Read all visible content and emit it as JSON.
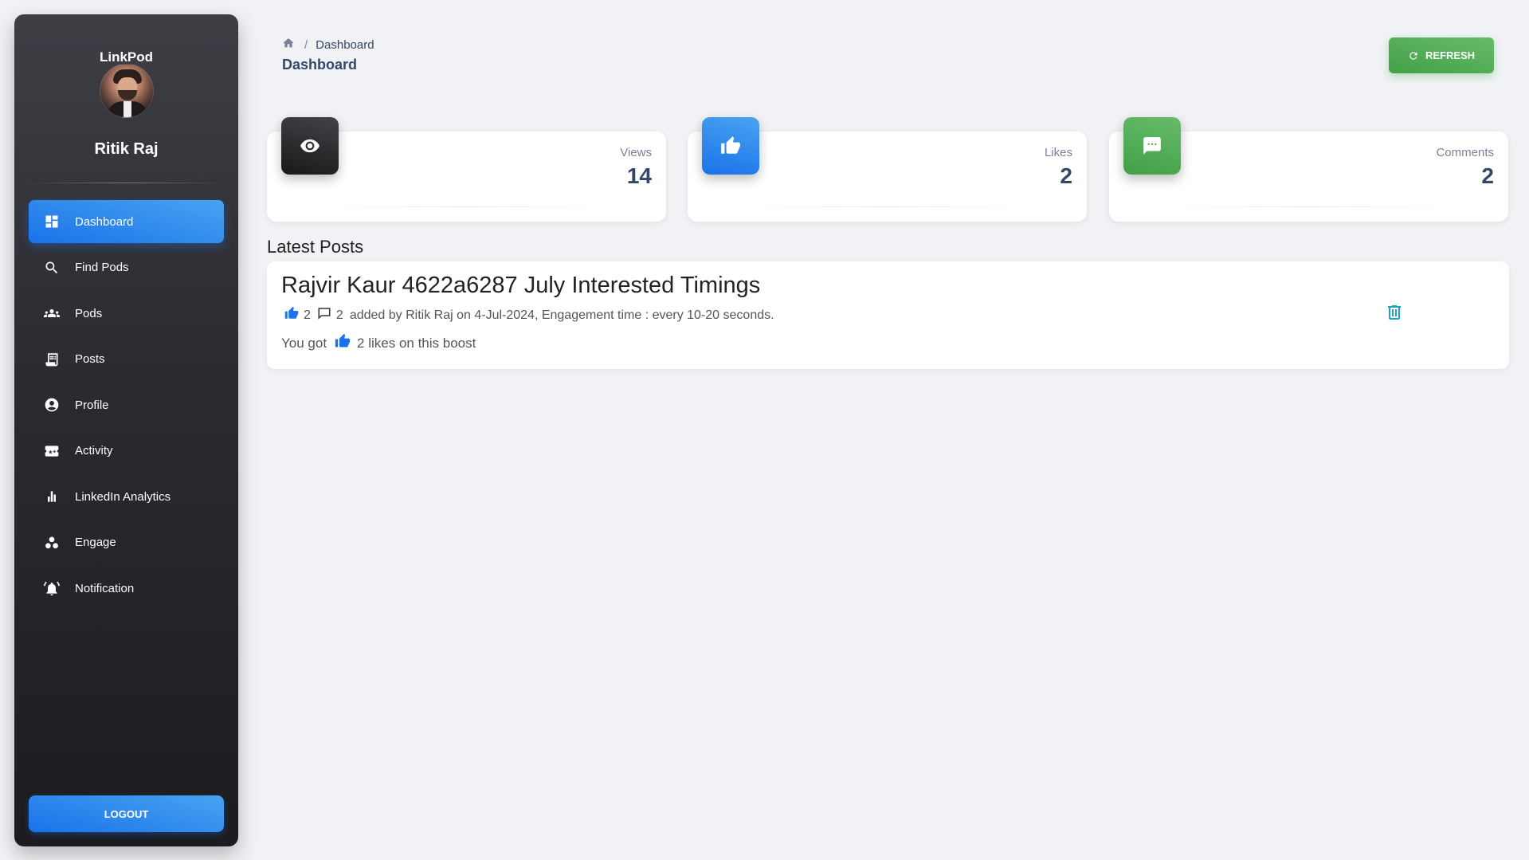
{
  "sidebar": {
    "brand": "LinkPod",
    "user_name": "Ritik Raj",
    "items": [
      {
        "label": "Dashboard",
        "icon": "dashboard-icon",
        "active": true
      },
      {
        "label": "Find Pods",
        "icon": "search-icon",
        "active": false
      },
      {
        "label": "Pods",
        "icon": "groups-icon",
        "active": false
      },
      {
        "label": "Posts",
        "icon": "receipt-icon",
        "active": false
      },
      {
        "label": "Profile",
        "icon": "account-circle-icon",
        "active": false
      },
      {
        "label": "Activity",
        "icon": "ticket-icon",
        "active": false
      },
      {
        "label": "LinkedIn Analytics",
        "icon": "bar-chart-icon",
        "active": false
      },
      {
        "label": "Engage",
        "icon": "workspaces-icon",
        "active": false
      },
      {
        "label": "Notification",
        "icon": "alarm-icon",
        "active": false
      }
    ],
    "logout_label": "LOGOUT"
  },
  "header": {
    "breadcrumb": "Dashboard",
    "title": "Dashboard",
    "refresh_label": "REFRESH"
  },
  "stats": [
    {
      "label": "Views",
      "value": "14",
      "icon": "eye-icon",
      "color": "#191919"
    },
    {
      "label": "Likes",
      "value": "2",
      "icon": "thumb-up-icon",
      "color": "#1a73e8"
    },
    {
      "label": "Comments",
      "value": "2",
      "icon": "comment-icon",
      "color": "#43a047"
    }
  ],
  "latest_posts": {
    "title": "Latest Posts",
    "posts": [
      {
        "title": "Rajvir Kaur 4622a6287 July Interested Timings",
        "likes": "2",
        "comments": "2",
        "meta": "added by Ritik Raj on 4-Jul-2024, Engagement time : every 10-20 seconds.",
        "got_prefix": "You got",
        "got_suffix": "2 likes on this boost"
      }
    ]
  },
  "colors": {
    "accent": "#1a73e8",
    "success": "#43a047",
    "background": "#f0f2f5"
  }
}
